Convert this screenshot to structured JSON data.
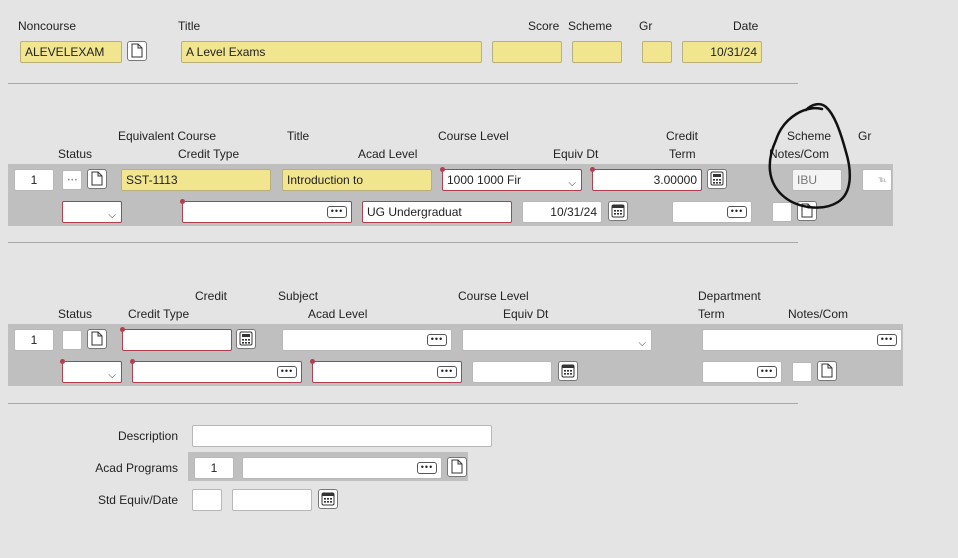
{
  "header": {
    "labels": {
      "noncourse": "Noncourse",
      "title": "Title",
      "score": "Score",
      "scheme": "Scheme",
      "gr": "Gr",
      "date": "Date"
    },
    "noncourse_value": "ALEVELEXAM",
    "title_value": "A Level Exams",
    "date_value": "10/31/24"
  },
  "equiv_section": {
    "labels": {
      "equivalent_course": "Equivalent Course",
      "title": "Title",
      "course_level": "Course Level",
      "credit": "Credit",
      "scheme": "Scheme",
      "gr": "Gr",
      "status": "Status",
      "credit_type": "Credit Type",
      "acad_level": "Acad Level",
      "equiv_dt": "Equiv Dt",
      "term": "Term",
      "notes_com": "Notes/Com"
    },
    "row_number": "1",
    "course_value": "SST-1113",
    "title_value": "Introduction to",
    "course_level_value": "1000 1000 Fir",
    "credit_value": "3.00000",
    "scheme_value": "IBU",
    "acad_level_value": "UG Undergraduat",
    "equiv_dt_value": "10/31/24",
    "dots": "•••",
    "chevron": "⌄",
    "annotation_color": "#111111"
  },
  "credit_section": {
    "labels": {
      "credit": "Credit",
      "subject": "Subject",
      "course_level": "Course Level",
      "department": "Department",
      "status": "Status",
      "credit_type": "Credit Type",
      "acad_level": "Acad Level",
      "equiv_dt": "Equiv Dt",
      "term": "Term",
      "notes_com": "Notes/Com"
    },
    "row_number": "1"
  },
  "bottom": {
    "labels": {
      "description": "Description",
      "acad_programs": "Acad Programs",
      "std_equiv_date": "Std Equiv/Date"
    },
    "acad_programs_row": "1"
  },
  "icons": [
    "document-icon",
    "calculator-icon",
    "calendar-icon",
    "lookup-icon",
    "chevron-down-icon"
  ],
  "colors": {
    "required": "#b04050",
    "highlight": "#f1e68f",
    "band": "#bfbfbf"
  }
}
